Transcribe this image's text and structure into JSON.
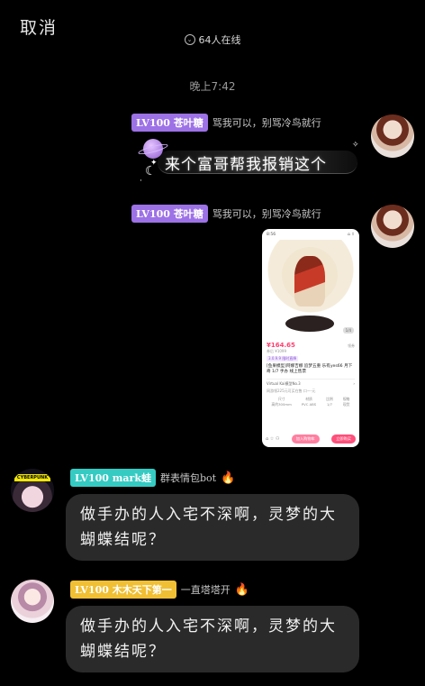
{
  "header": {
    "cancel_label": "取消",
    "online_text": "64人在线",
    "online_icon": "chevron-down-circle-icon"
  },
  "timestamp": "晚上7:42",
  "messages": [
    {
      "side": "right",
      "level": "LV100",
      "name": "苍叶糖",
      "title": "骂我可以，别骂冷鸟就行",
      "badge_color": "#9d72e6",
      "text": "来个富哥帮我报销这个",
      "bubble_style": "planet-moon-sparkle"
    },
    {
      "side": "right",
      "level": "LV100",
      "name": "苍叶糖",
      "title": "骂我可以，别骂冷鸟就行",
      "badge_color": "#9d72e6",
      "image": {
        "status_time": "8:56",
        "price": "¥164.65",
        "orig_price": "¥164.65",
        "sub_price": "券后 ¥1099",
        "tag": "3.0.9.9  限时直降",
        "shop_tag": "领券",
        "title": "[鱼果模型]阿娜吉娜 追梦五重 乐有yes66 月下奇 1/7 手办 线上售票",
        "shop_name": "Virtual Kai模型No.3",
        "shop_note": "网游领225元可买在售  口ー-元  ",
        "params": [
          {
            "k": "尺寸",
            "v": "高约300mm"
          },
          {
            "k": "材质",
            "v": "PVC ABS"
          },
          {
            "k": "比例",
            "v": "1/7"
          },
          {
            "k": "规格",
            "v": "现货"
          }
        ],
        "btn_primary": "立即购买",
        "btn_secondary": "加入购物车"
      }
    },
    {
      "side": "left",
      "level": "LV100",
      "name": "mark蛙",
      "title": "群表情包bot",
      "badge_color": "#35cbc3",
      "text": "做手办的人入宅不深啊，灵梦的大蝴蝶结呢？"
    },
    {
      "side": "left",
      "level": "LV100",
      "name": "木木天下第一",
      "title": "一直塔塔开",
      "badge_color": "#f0bf33",
      "text": "做手办的人入宅不深啊，灵梦的大蝴蝶结呢？"
    }
  ]
}
